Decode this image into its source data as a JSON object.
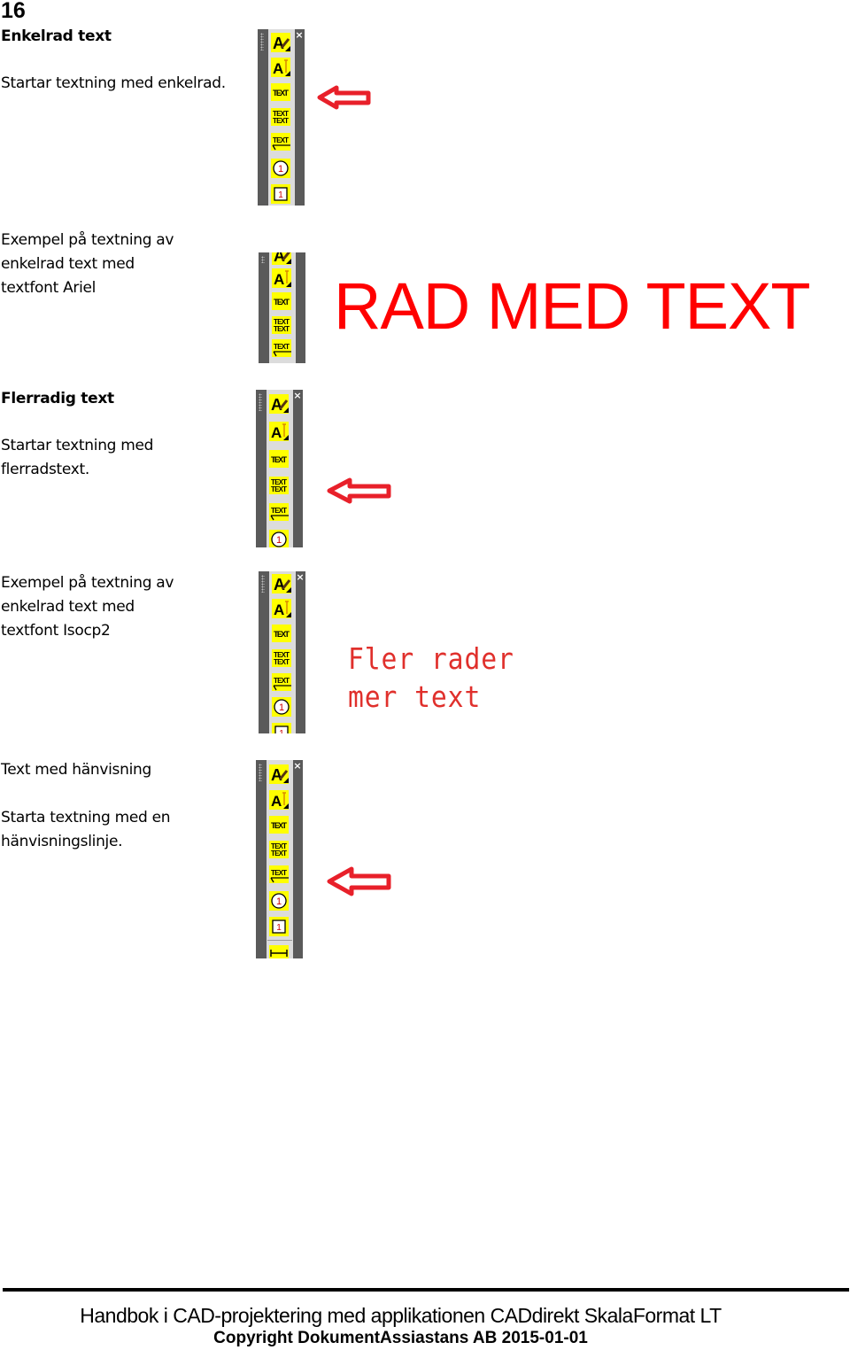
{
  "page": {
    "number": "16"
  },
  "sections": [
    {
      "heading": "Enkelrad text",
      "description": "Startar textning med enkelrad."
    },
    {
      "example_lines": [
        "Exempel på textning av",
        "enkelrad text med",
        "textfont Ariel"
      ],
      "sample_text": "RAD MED TEXT"
    },
    {
      "heading": "Flerradig text",
      "description_lines": [
        "Startar textning med",
        "flerradstext."
      ]
    },
    {
      "example_lines": [
        "Exempel på textning av",
        "enkelrad text med",
        "textfont Isocp2"
      ],
      "sample_lines": [
        "Fler rader",
        "mer text"
      ]
    },
    {
      "heading": "Text med hänvisning",
      "description_lines": [
        "Starta textning med en",
        "hänvisningslinje."
      ]
    }
  ],
  "toolbar": {
    "close_glyph": "×",
    "buttons": [
      {
        "icon": "text-style-icon",
        "label": "A"
      },
      {
        "icon": "text-height-icon",
        "label": "A"
      },
      {
        "icon": "single-line-text-icon",
        "label": "TEXT"
      },
      {
        "icon": "multiline-text-icon",
        "label": "TEXT"
      },
      {
        "icon": "leader-text-icon",
        "label": "TEXT"
      },
      {
        "icon": "balloon-circle-icon",
        "label": "1"
      },
      {
        "icon": "balloon-square-icon",
        "label": "1"
      },
      {
        "icon": "dimension-icon",
        "label": ""
      }
    ]
  },
  "colors": {
    "highlight_arrow": "#e8202a",
    "sample_text_red": "#ff0000",
    "icon_yellow": "#ffff00",
    "toolbar_dark": "#5a5a5a",
    "toolbar_light": "#dcdcdc"
  },
  "footer": {
    "title": "Handbok i CAD-projektering med applikationen CADdirekt SkalaFormat LT",
    "copyright": "Copyright DokumentAssiastans AB 2015-01-01"
  }
}
